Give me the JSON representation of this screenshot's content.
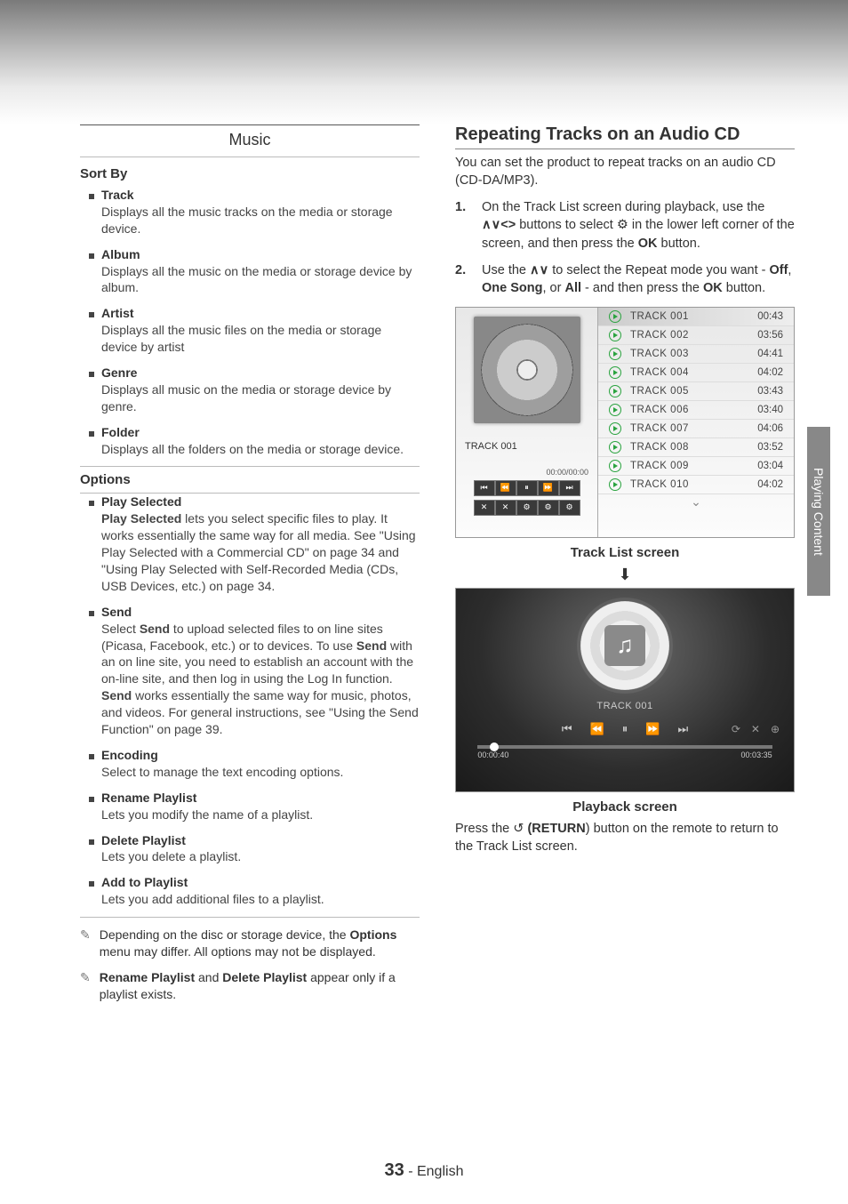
{
  "left": {
    "music_header": "Music",
    "sort_by_label": "Sort By",
    "sort_items": [
      {
        "title": "Track",
        "desc": "Displays all the music tracks on the media or storage device."
      },
      {
        "title": "Album",
        "desc": "Displays all the music on the media or storage device by album."
      },
      {
        "title": "Artist",
        "desc": "Displays all the music files on the media or storage device by artist"
      },
      {
        "title": "Genre",
        "desc": "Displays all music on the media or storage device by genre."
      },
      {
        "title": "Folder",
        "desc": "Displays all the folders on the media or storage device."
      }
    ],
    "options_label": "Options",
    "option_items": [
      {
        "title": "Play Selected",
        "desc_prefix": "Play Selected",
        "desc": " lets you select specific files to play. It works essentially the same way for all media. See \"Using Play Selected with a Commercial CD\" on page 34 and \"Using Play Selected with Self-Recorded Media (CDs, USB Devices, etc.) on page 34."
      },
      {
        "title": "Send",
        "desc_html": "Select <b>Send</b> to upload selected files to on line sites (Picasa, Facebook, etc.) or to devices. To use <b>Send</b> with an on line site, you need to establish an account with the on-line site, and then log in using the Log In function. <b>Send</b> works essentially the same way for music, photos, and videos. For general instructions, see \"Using the Send Function\" on page 39."
      },
      {
        "title": "Encoding",
        "desc": "Select to manage the text encoding options."
      },
      {
        "title": "Rename Playlist",
        "desc": "Lets you modify the name of a playlist."
      },
      {
        "title": "Delete Playlist",
        "desc": "Lets you delete a playlist."
      },
      {
        "title": "Add to Playlist",
        "desc": "Lets you add additional files to a playlist."
      }
    ],
    "notes": [
      "Depending on the disc or storage device, the <b>Options</b> menu may differ. All options may not be displayed.",
      "<b>Rename Playlist</b> and <b>Delete Playlist</b> appear only if a playlist exists."
    ]
  },
  "right": {
    "title": "Repeating Tracks on an Audio CD",
    "intro": "You can set the product to repeat tracks on an audio CD (CD-DA/MP3).",
    "step1_a": "On the Track List screen during playback, use the ",
    "step1_nav": "∧∨<>",
    "step1_b": " buttons to select ",
    "step1_gear": "⚙",
    "step1_c": " in the lower left corner of the screen, and then press the ",
    "step1_ok": "OK",
    "step1_d": " button.",
    "step2_a": "Use the ",
    "step2_nav": "∧∨",
    "step2_b": " to select the Repeat mode you want - ",
    "step2_off": "Off",
    "step2_comma": ", ",
    "step2_one": "One Song",
    "step2_or": ", or ",
    "step2_all": "All",
    "step2_c": " - and then press the ",
    "step2_ok": "OK",
    "step2_d": " button.",
    "track_screen": {
      "now_playing": "TRACK 001",
      "elapsed": "00:00/00:00",
      "controls": [
        "⏮",
        "⏪",
        "⏸",
        "⏩",
        "⏭"
      ],
      "controls2": [
        "✕",
        "✕",
        "⚙",
        "⚙",
        "⚙"
      ],
      "tracks": [
        {
          "name": "TRACK 001",
          "dur": "00:43",
          "selected": true
        },
        {
          "name": "TRACK 002",
          "dur": "03:56"
        },
        {
          "name": "TRACK 003",
          "dur": "04:41"
        },
        {
          "name": "TRACK 004",
          "dur": "04:02"
        },
        {
          "name": "TRACK 005",
          "dur": "03:43"
        },
        {
          "name": "TRACK 006",
          "dur": "03:40"
        },
        {
          "name": "TRACK 007",
          "dur": "04:06"
        },
        {
          "name": "TRACK 008",
          "dur": "03:52"
        },
        {
          "name": "TRACK 009",
          "dur": "03:04"
        },
        {
          "name": "TRACK 010",
          "dur": "04:02"
        }
      ]
    },
    "caption1": "Track List screen",
    "playback": {
      "name": "TRACK 001",
      "left_time": "00:00:40",
      "right_time": "00:03:35",
      "controls": [
        "⏮",
        "⏪",
        "⏸",
        "⏩",
        "⏭"
      ]
    },
    "caption2": "Playback screen",
    "after_a": "Press the ",
    "after_ret_sym": "↺",
    "after_ret": " (RETURN",
    "after_b": ") button on the remote to return to the Track List screen."
  },
  "side_tab": "Playing Content",
  "footer": {
    "page": "33",
    "lang": " - English"
  }
}
